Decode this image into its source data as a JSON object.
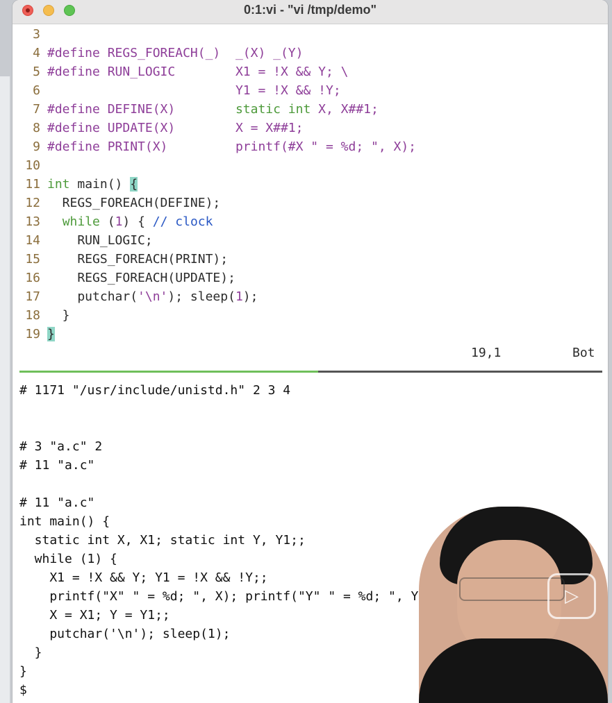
{
  "window": {
    "title": "0:1:vi - \"vi /tmp/demo\""
  },
  "editor": {
    "lines": [
      {
        "n": "3",
        "segs": []
      },
      {
        "n": "4",
        "segs": [
          {
            "c": "pp",
            "t": "#define REGS_FOREACH(_)  "
          },
          {
            "c": "st",
            "t": "_(X) _(Y)"
          }
        ]
      },
      {
        "n": "5",
        "segs": [
          {
            "c": "pp",
            "t": "#define RUN_LOGIC        "
          },
          {
            "c": "st",
            "t": "X1 = !X && Y; \\"
          }
        ]
      },
      {
        "n": "6",
        "segs": [
          {
            "c": "",
            "t": "                         "
          },
          {
            "c": "st",
            "t": "Y1 = !X && !Y;"
          }
        ]
      },
      {
        "n": "7",
        "segs": [
          {
            "c": "pp",
            "t": "#define DEFINE(X)        "
          },
          {
            "c": "kw",
            "t": "static int"
          },
          {
            "c": "st",
            "t": " X, X##1;"
          }
        ]
      },
      {
        "n": "8",
        "segs": [
          {
            "c": "pp",
            "t": "#define UPDATE(X)        "
          },
          {
            "c": "st",
            "t": "X = X##1;"
          }
        ]
      },
      {
        "n": "9",
        "segs": [
          {
            "c": "pp",
            "t": "#define PRINT(X)         "
          },
          {
            "c": "st",
            "t": "printf(#X \" = %d; \", X);"
          }
        ]
      },
      {
        "n": "10",
        "segs": []
      },
      {
        "n": "11",
        "segs": [
          {
            "c": "kw",
            "t": "int"
          },
          {
            "c": "",
            "t": " main() "
          },
          {
            "c": "cursorbox",
            "t": "{"
          }
        ]
      },
      {
        "n": "12",
        "segs": [
          {
            "c": "",
            "t": "  REGS_FOREACH(DEFINE);"
          }
        ]
      },
      {
        "n": "13",
        "segs": [
          {
            "c": "",
            "t": "  "
          },
          {
            "c": "kw",
            "t": "while"
          },
          {
            "c": "",
            "t": " ("
          },
          {
            "c": "nb",
            "t": "1"
          },
          {
            "c": "",
            "t": ") { "
          },
          {
            "c": "cm",
            "t": "// clock"
          }
        ]
      },
      {
        "n": "14",
        "segs": [
          {
            "c": "",
            "t": "    RUN_LOGIC;"
          }
        ]
      },
      {
        "n": "15",
        "segs": [
          {
            "c": "",
            "t": "    REGS_FOREACH(PRINT);"
          }
        ]
      },
      {
        "n": "16",
        "segs": [
          {
            "c": "",
            "t": "    REGS_FOREACH(UPDATE);"
          }
        ]
      },
      {
        "n": "17",
        "segs": [
          {
            "c": "",
            "t": "    putchar("
          },
          {
            "c": "st",
            "t": "'\\n'"
          },
          {
            "c": "",
            "t": "); sleep("
          },
          {
            "c": "nb",
            "t": "1"
          },
          {
            "c": "",
            "t": ");"
          }
        ]
      },
      {
        "n": "18",
        "segs": [
          {
            "c": "",
            "t": "  }"
          }
        ]
      },
      {
        "n": "19",
        "segs": [
          {
            "c": "cursorbox",
            "t": "}"
          }
        ]
      }
    ],
    "status": {
      "position": "19,1",
      "scroll": "Bot"
    }
  },
  "terminal": {
    "lines": [
      "# 1171 \"/usr/include/unistd.h\" 2 3 4",
      "",
      "",
      "# 3 \"a.c\" 2",
      "# 11 \"a.c\"",
      "",
      "# 11 \"a.c\"",
      "int main() {",
      "  static int X, X1; static int Y, Y1;;",
      "  while (1) {",
      "    X1 = !X && Y; Y1 = !X && !Y;;",
      "    printf(\"X\" \" = %d; \", X); printf(\"Y\" \" = %d; \", Y);;",
      "    X = X1; Y = Y1;;",
      "    putchar('\\n'); sleep(1);",
      "  }",
      "}",
      "$"
    ]
  },
  "overlay": {
    "play_icon": "play-icon"
  }
}
